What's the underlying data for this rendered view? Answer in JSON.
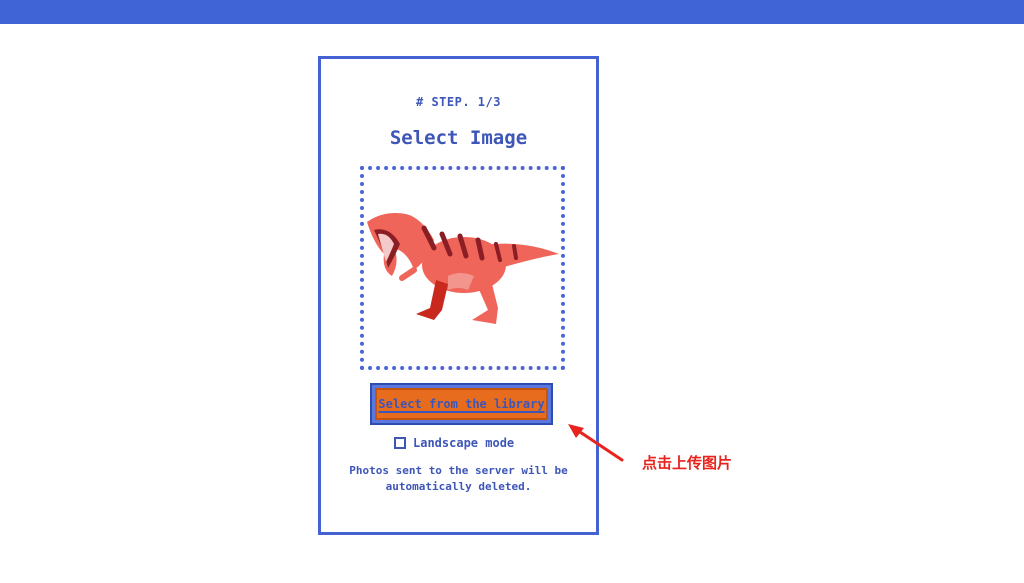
{
  "app": {
    "step_label": "# STEP. 1/3",
    "title": "Select Image"
  },
  "dropzone": {
    "image": "dinosaur-illustration",
    "border_color": "#4a66d4"
  },
  "actions": {
    "select_button_label": "Select from the library",
    "landscape_label": "Landscape mode",
    "landscape_checked": false
  },
  "notice": {
    "line1": "Photos sent to the server will be",
    "line2": "automatically deleted."
  },
  "annotation": {
    "label": "点击上传图片",
    "color": "#e8231d"
  },
  "colors": {
    "brand": "#4064d6",
    "button": "#e86c1e",
    "text": "#3d56b8"
  }
}
